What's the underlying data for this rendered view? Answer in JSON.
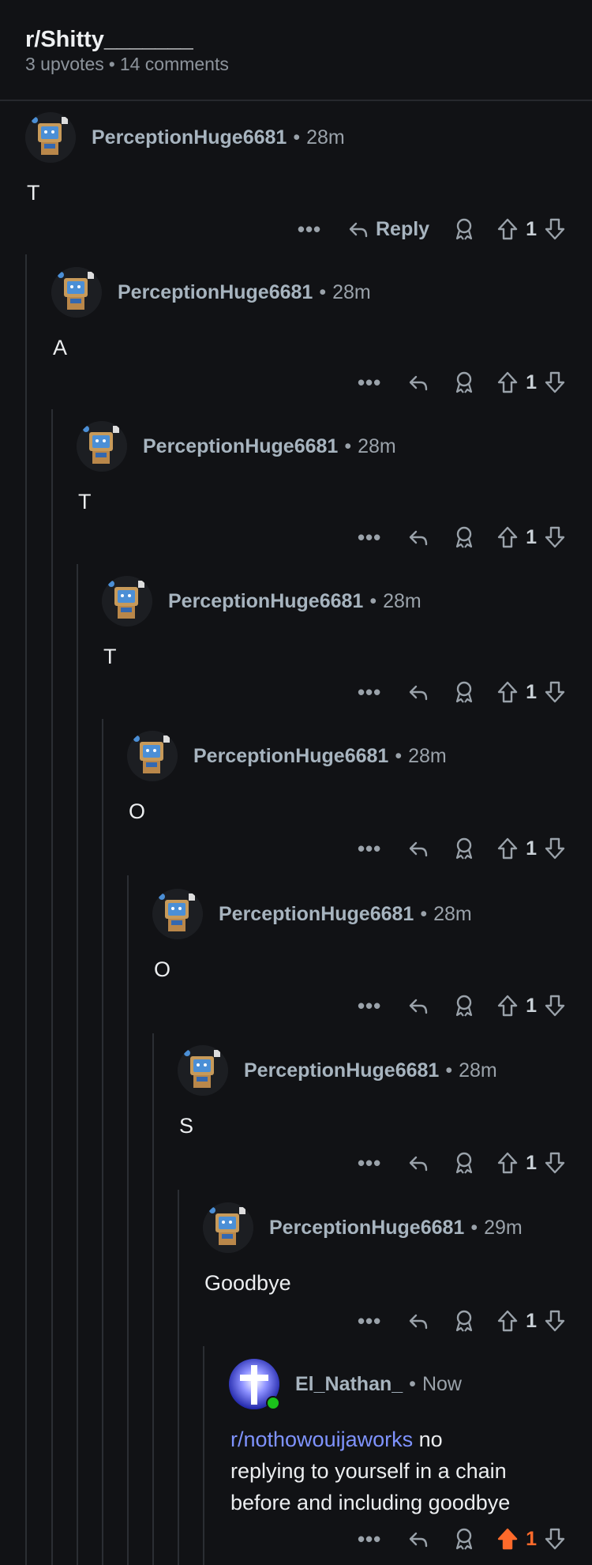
{
  "header": {
    "subreddit": "r/Shitty_______",
    "upvotes": "3 upvotes",
    "dot": "•",
    "comments": "14 comments"
  },
  "comments": [
    {
      "author": "PerceptionHuge6681",
      "time": "28m",
      "body": "T",
      "votes": "1",
      "reply_label": "Reply"
    },
    {
      "author": "PerceptionHuge6681",
      "time": "28m",
      "body": "A",
      "votes": "1"
    },
    {
      "author": "PerceptionHuge6681",
      "time": "28m",
      "body": "T",
      "votes": "1"
    },
    {
      "author": "PerceptionHuge6681",
      "time": "28m",
      "body": "T",
      "votes": "1"
    },
    {
      "author": "PerceptionHuge6681",
      "time": "28m",
      "body": "O",
      "votes": "1"
    },
    {
      "author": "PerceptionHuge6681",
      "time": "28m",
      "body": "O",
      "votes": "1"
    },
    {
      "author": "PerceptionHuge6681",
      "time": "28m",
      "body": "S",
      "votes": "1"
    },
    {
      "author": "PerceptionHuge6681",
      "time": "29m",
      "body": "Goodbye",
      "votes": "1"
    },
    {
      "author": "El_Nathan_",
      "time": "Now",
      "body_link": "r/nothowouijaworks",
      "body_text": "no",
      "body_line2": "replying to yourself in a chain",
      "body_line3": "before and including goodbye",
      "votes": "1",
      "upvoted": true
    }
  ],
  "icons": [
    "more-icon",
    "reply-icon",
    "award-icon",
    "upvote-icon",
    "downvote-icon",
    "cross-avatar-icon",
    "robot-avatar-icon"
  ],
  "colors": {
    "background": "#111215",
    "username": "#a7b4bf",
    "link": "#7f93ff",
    "upvoted": "#ff6a2b",
    "online": "#1bc21b"
  }
}
